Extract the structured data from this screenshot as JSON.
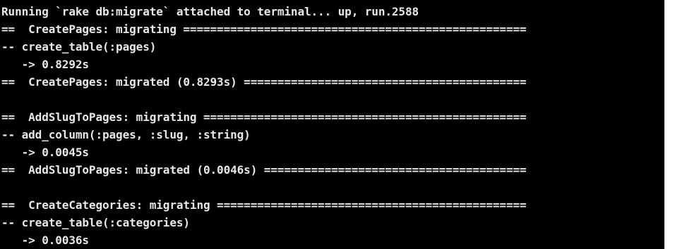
{
  "terminal": {
    "lines": [
      "Running `rake db:migrate` attached to terminal... up, run.2588",
      "==  CreatePages: migrating ===================================================",
      "-- create_table(:pages)",
      "   -> 0.8292s",
      "==  CreatePages: migrated (0.8293s) ==========================================",
      "",
      "==  AddSlugToPages: migrating ================================================",
      "-- add_column(:pages, :slug, :string)",
      "   -> 0.0045s",
      "==  AddSlugToPages: migrated (0.0046s) =======================================",
      "",
      "==  CreateCategories: migrating ==============================================",
      "-- create_table(:categories)",
      "   -> 0.0036s"
    ]
  }
}
